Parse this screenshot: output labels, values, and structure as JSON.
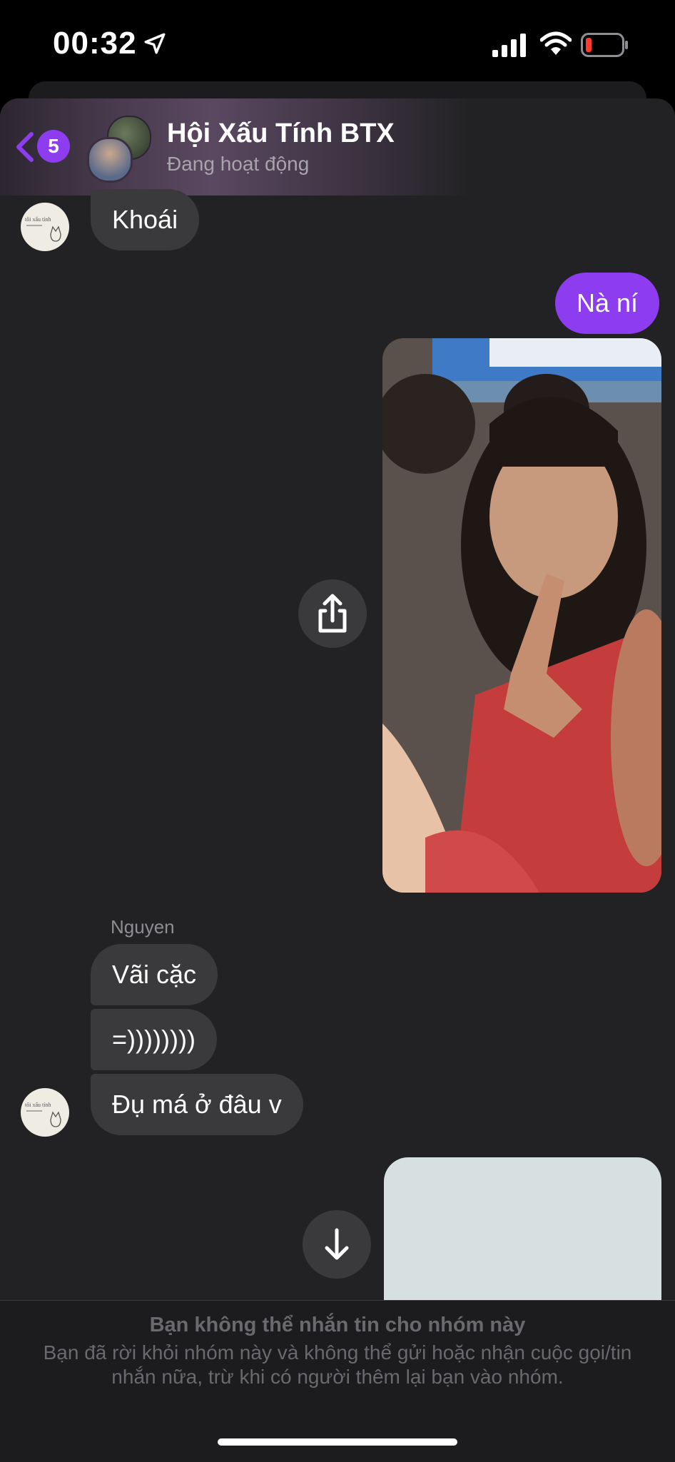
{
  "status_bar": {
    "time": "00:32"
  },
  "header": {
    "back_badge_count": "5",
    "group_name": "Hội Xấu Tính BTX",
    "group_status": "Đang hoạt động"
  },
  "messages": {
    "incoming_1": "Khoái",
    "outgoing_1": "Nà ní",
    "sender_name": "Nguyen",
    "incoming_2": "Vãi cặc",
    "incoming_3": "=))))))))",
    "incoming_4": "Đụ má ở đâu v"
  },
  "footer": {
    "title": "Bạn không thể nhắn tin cho nhóm này",
    "body": "Bạn đã rời khỏi nhóm này và không thể gửi hoặc nhận cuộc gọi/tin nhắn nữa, trừ khi có người thêm lại bạn vào nhóm."
  },
  "colors": {
    "accent": "#8e3cf0",
    "background": "#222224",
    "bubble_incoming": "#3a3a3c"
  }
}
